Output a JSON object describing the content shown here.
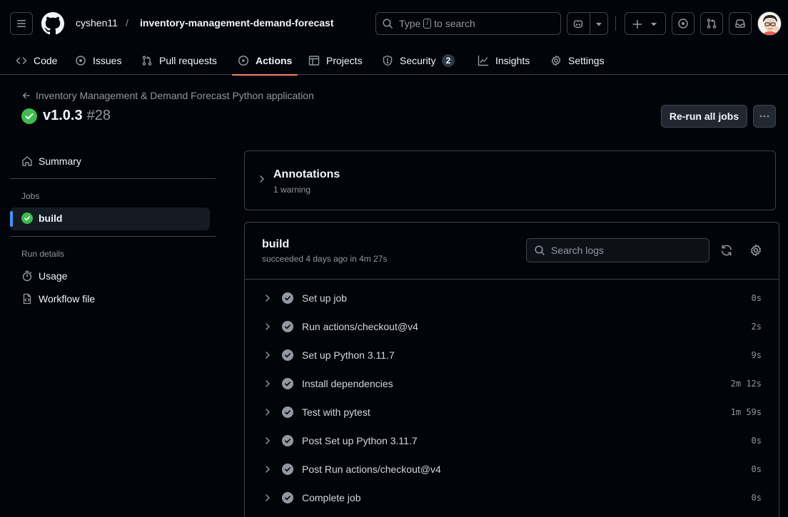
{
  "header": {
    "owner": "cyshen11",
    "separator": "/",
    "repo": "inventory-management-demand-forecast",
    "search": {
      "prefix": "Type",
      "key": "/",
      "suffix": "to search"
    }
  },
  "nav": {
    "tabs": [
      {
        "label": "Code",
        "icon": "code-icon"
      },
      {
        "label": "Issues",
        "icon": "issue-icon"
      },
      {
        "label": "Pull requests",
        "icon": "pull-request-icon"
      },
      {
        "label": "Actions",
        "icon": "play-icon",
        "active": true
      },
      {
        "label": "Projects",
        "icon": "table-icon"
      },
      {
        "label": "Security",
        "icon": "shield-icon",
        "count": "2"
      },
      {
        "label": "Insights",
        "icon": "graph-icon"
      },
      {
        "label": "Settings",
        "icon": "gear-icon"
      }
    ]
  },
  "run": {
    "workflow": "Inventory Management & Demand Forecast Python application",
    "name": "v1.0.3",
    "number": "#28",
    "rerun_label": "Re-run all jobs",
    "status_color": "#3fb950"
  },
  "sidebar": {
    "summary": "Summary",
    "jobs_heading": "Jobs",
    "job": "build",
    "run_details_heading": "Run details",
    "usage": "Usage",
    "workflow_file": "Workflow file"
  },
  "annotations": {
    "title": "Annotations",
    "subtitle": "1 warning"
  },
  "job": {
    "title": "build",
    "subtitle": "succeeded 4 days ago in 4m 27s",
    "search_placeholder": "Search logs",
    "steps": [
      {
        "label": "Set up job",
        "duration": "0s"
      },
      {
        "label": "Run actions/checkout@v4",
        "duration": "2s"
      },
      {
        "label": "Set up Python 3.11.7",
        "duration": "9s"
      },
      {
        "label": "Install dependencies",
        "duration": "2m 12s"
      },
      {
        "label": "Test with pytest",
        "duration": "1m 59s"
      },
      {
        "label": "Post Set up Python 3.11.7",
        "duration": "0s"
      },
      {
        "label": "Post Run actions/checkout@v4",
        "duration": "0s"
      },
      {
        "label": "Complete job",
        "duration": "0s"
      }
    ]
  },
  "colors": {
    "background": "#010409",
    "border": "#3d444d",
    "accent_underline": "#f78166",
    "success": "#3fb950",
    "active_indicator": "#4493f8"
  }
}
